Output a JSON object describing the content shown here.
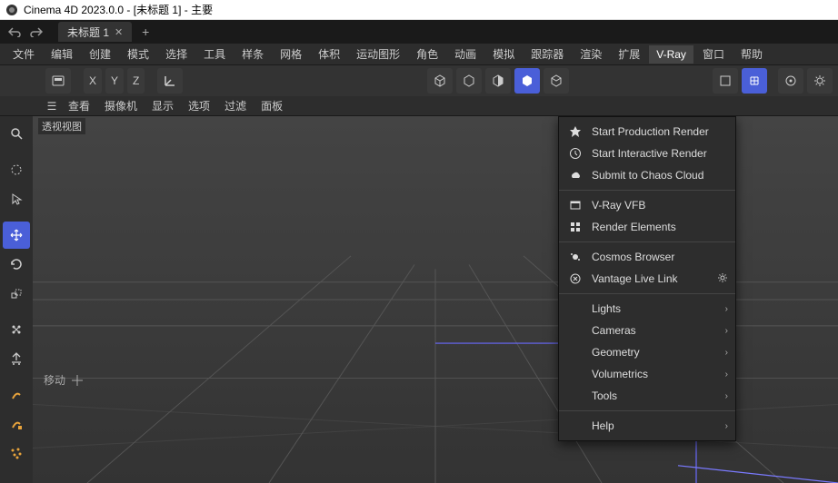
{
  "window": {
    "title": "Cinema 4D 2023.0.0 - [未标题 1] - 主要"
  },
  "tabs": {
    "active": "未标题 1"
  },
  "menubar": [
    "文件",
    "编辑",
    "创建",
    "模式",
    "选择",
    "工具",
    "样条",
    "网格",
    "体积",
    "运动图形",
    "角色",
    "动画",
    "模拟",
    "跟踪器",
    "渲染",
    "扩展",
    "V-Ray",
    "窗口",
    "帮助"
  ],
  "menubar_active_index": 16,
  "axis": {
    "x": "X",
    "y": "Y",
    "z": "Z"
  },
  "view_toolbar": [
    "查看",
    "摄像机",
    "显示",
    "选项",
    "过滤",
    "面板"
  ],
  "viewport": {
    "label": "透视视图"
  },
  "hint": {
    "label": "移动"
  },
  "vray_menu": {
    "group1": [
      {
        "icon": "render-icon",
        "label": "Start Production Render"
      },
      {
        "icon": "clock-icon",
        "label": "Start Interactive Render"
      },
      {
        "icon": "cloud-icon",
        "label": "Submit to Chaos Cloud"
      }
    ],
    "group2": [
      {
        "icon": "vfb-icon",
        "label": "V-Ray VFB"
      },
      {
        "icon": "elements-icon",
        "label": "Render Elements"
      }
    ],
    "group3": [
      {
        "icon": "cosmos-icon",
        "label": "Cosmos Browser"
      },
      {
        "icon": "vantage-icon",
        "label": "Vantage Live Link",
        "gear": true
      }
    ],
    "group4": [
      {
        "label": "Lights",
        "sub": true
      },
      {
        "label": "Cameras",
        "sub": true
      },
      {
        "label": "Geometry",
        "sub": true
      },
      {
        "label": "Volumetrics",
        "sub": true
      },
      {
        "label": "Tools",
        "sub": true
      }
    ],
    "group5": [
      {
        "label": "Help",
        "sub": true
      }
    ]
  }
}
